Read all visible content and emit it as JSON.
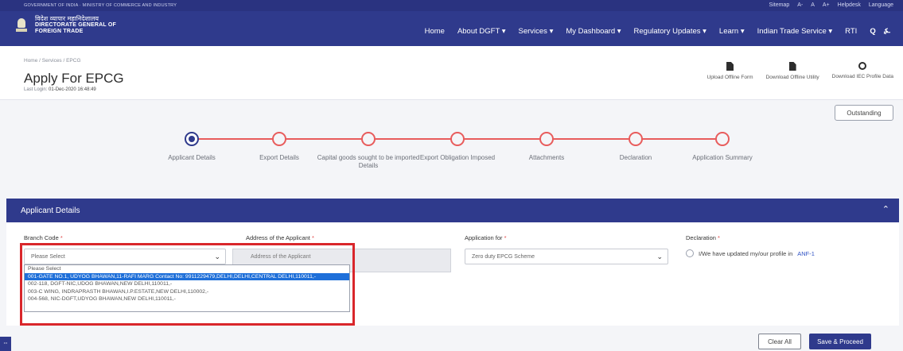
{
  "header": {
    "gov_strip": "GOVERNMENT OF INDIA · MINISTRY OF COMMERCE AND INDUSTRY",
    "top_links": [
      "Sitemap",
      "A-",
      "A",
      "A+",
      "Helpdesk",
      "Language"
    ],
    "logo_hindi": "विदेश व्यापार महानिदेशालय",
    "logo_line1": "DIRECTORATE GENERAL OF",
    "logo_line2": "FOREIGN TRADE",
    "nav": [
      "Home",
      "About DGFT ▾",
      "Services ▾",
      "My Dashboard ▾",
      "Regulatory Updates ▾",
      "Learn ▾",
      "Indian Trade Service ▾",
      "RTI"
    ],
    "search_glyph": "Q",
    "bell_glyph": "♫"
  },
  "page": {
    "breadcrumb": "Home / Services / EPCG",
    "title": "Apply For EPCG",
    "last_login_label": "Last Login:",
    "last_login_value": "01-Dec-2020 16:48:49",
    "actions": [
      "Upload Offline Form",
      "Download Offline Utility",
      "Download IEC Profile Data"
    ],
    "outstanding": "Outstanding"
  },
  "steps": [
    "Applicant Details",
    "Export Details",
    "Capital goods sought to be imported Details",
    "Export Obligation Imposed",
    "Attachments",
    "Declaration",
    "Application Summary"
  ],
  "section": {
    "title": "Applicant Details",
    "collapse_glyph": "⌃",
    "branch_label": "Branch Code",
    "branch_value": "Please Select",
    "address_label": "Address of the Applicant",
    "address_placeholder": "Address of the Applicant",
    "application_for_label": "Application for",
    "application_for_value": "Zero duty EPCG Scheme",
    "declaration_label": "Declaration",
    "declaration_text": "I/We have updated my/our profile in",
    "declaration_link": "ANF-1",
    "required_mark": "*"
  },
  "dropdown": {
    "options": [
      "Please Select",
      "001-GATE NO.1, UDYOG BHAWAN,11-RAFI MARG Contact No: 9911229479,DELHI,DELHI,CENTRAL DELHI,110011,-",
      "002-118, DGFT-NIC,UDOG BHAWAN,NEW DELHI,110011,-",
      "003-C WING, INDRAPRASTH BHAWAN,I.P.ESTATE,NEW DELHI,110002,-",
      "004-568, NIC-DGFT,UDYOG BHAWAN,NEW DELHI,110011,-"
    ],
    "selected_index": 1
  },
  "buttons": {
    "clear": "Clear All",
    "save": "Save & Proceed",
    "side_tab": "ⵈ"
  },
  "colors": {
    "brand": "#2f3a8c",
    "step": "#e85c5c",
    "highlight": "#d9262b",
    "selected": "#1e6fd9"
  }
}
